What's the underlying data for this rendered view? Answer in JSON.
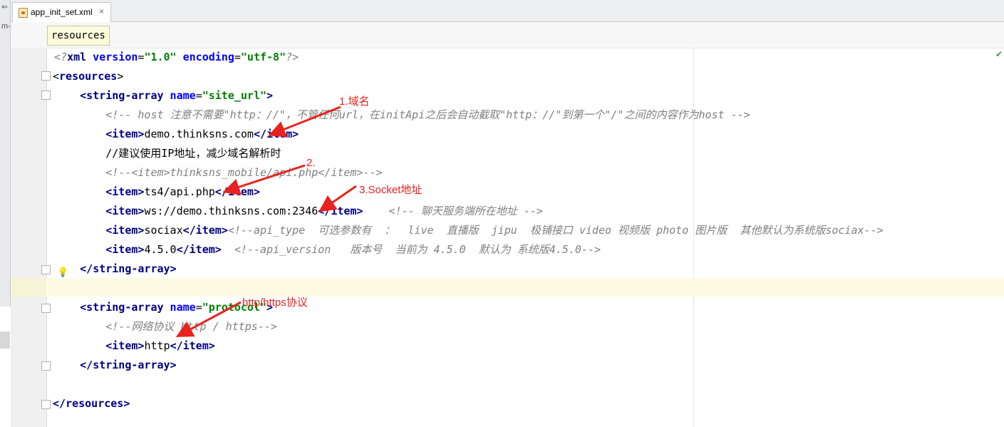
{
  "tab": {
    "title": "app_init_set.xml",
    "close": "×"
  },
  "breadcrumb": "resources",
  "left_strip": {
    "g1": "⇐",
    "g2": "m-"
  },
  "code_lines": [
    {
      "prolog": "<?",
      "xml": "xml",
      "version_attr": " version",
      "eq1": "=",
      "version_val": "\"1.0\"",
      "enc_attr": " encoding",
      "eq2": "=",
      "enc_val": "\"utf-8\"",
      "end": "?>"
    },
    {
      "open": "<",
      "tag": "resources",
      "close": ">"
    },
    {
      "indent": "    ",
      "open": "<",
      "tag": "string-array",
      "attr": " name",
      "eq": "=",
      "val": "\"site_url\"",
      "close": ">"
    },
    {
      "indent": "        ",
      "comment": "<!-- host 注意不需要\"http：//\"，不管任何url，在initApi之后会自动截取\"http：//\"到第一个\"/\"之间的内容作为host -->"
    },
    {
      "indent": "        ",
      "open": "<item>",
      "text": "demo.thinksns.com",
      "close": "</item>"
    },
    {
      "indent": "        ",
      "text": "//建议使用IP地址，减少域名解析时"
    },
    {
      "indent": "        ",
      "comment": "<!--<item>thinksns_mobile/api.php</item>-->"
    },
    {
      "indent": "        ",
      "open": "<item>",
      "text": "ts4/api.php",
      "close": "</item>"
    },
    {
      "indent": "        ",
      "open": "<item>",
      "text": "ws://demo.thinksns.com:2346",
      "close": "</item>",
      "comment": "    <!-- 聊天服务端所在地址 -->"
    },
    {
      "indent": "        ",
      "open": "<item>",
      "text": "sociax",
      "close": "</item>",
      "comment": "<!--api_type  可选参数有  ：  live  直播版  jipu  极铺接口 video 视频版 photo 图片版  其他默认为系统版sociax-->"
    },
    {
      "indent": "        ",
      "open": "<item>",
      "text": "4.5.0",
      "close": "</item>",
      "comment": "  <!--api_version   版本号  当前为 4.5.0  默认为 系统版4.5.0-->"
    },
    {
      "indent": "    ",
      "open": "</",
      "tag": "string-array",
      "close": ">"
    },
    {
      "indent": ""
    },
    {
      "indent": "    ",
      "open": "<",
      "tag": "string-array",
      "attr": " name",
      "eq": "=",
      "val": "\"protocol\"",
      "close": ">"
    },
    {
      "indent": "        ",
      "comment": "<!--网络协议 http / https-->"
    },
    {
      "indent": "        ",
      "open": "<item>",
      "text": "http",
      "close": "</item>"
    },
    {
      "indent": "    ",
      "open": "</",
      "tag": "string-array",
      "close": ">"
    },
    {
      "indent": ""
    },
    {
      "open": "</",
      "tag": "resources",
      "close": ">"
    }
  ],
  "annotations": {
    "a1": "1.域名",
    "a2": "2.",
    "a3": "3.Socket地址",
    "a4": "http/https协议"
  },
  "colors": {
    "arrow": "#e8231f",
    "tag": "#000080",
    "attr": "#0000ff",
    "string": "#008000",
    "comment": "#808080",
    "caret_line": "#fdfbe3"
  }
}
